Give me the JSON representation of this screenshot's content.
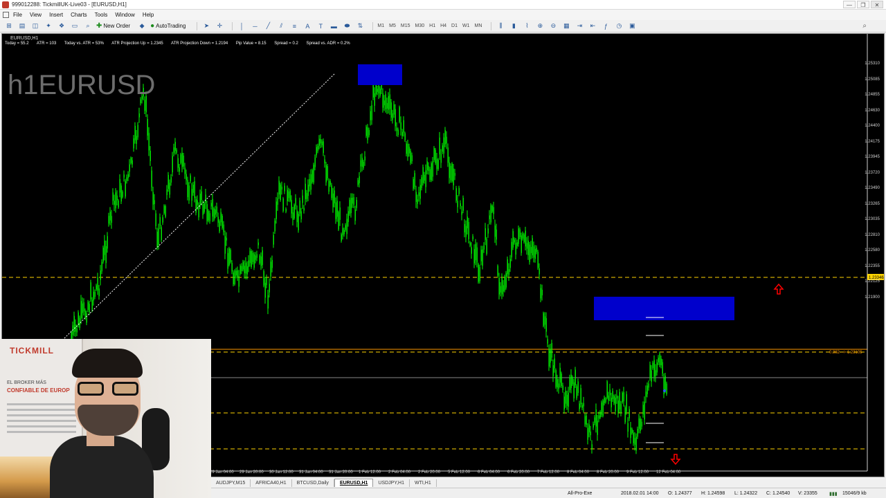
{
  "window": {
    "title": "999012288: TickmillUK-Live03 - [EURUSD,H1]",
    "controls": [
      "—",
      "❐",
      "✕"
    ]
  },
  "menu": [
    "File",
    "View",
    "Insert",
    "Charts",
    "Tools",
    "Window",
    "Help"
  ],
  "toolbar": {
    "new_order": "New Order",
    "autotrading": "AutoTrading",
    "timeframes": [
      "M1",
      "M5",
      "M15",
      "M30",
      "H1",
      "H4",
      "D1",
      "W1",
      "MN"
    ],
    "search_icon": "search-icon"
  },
  "chart": {
    "label": "EURUSD,H1",
    "watermark": "h1EURUSD",
    "info": {
      "today": "Today = 55.2",
      "atr": "ATR = 103",
      "today_vs_atr": "Today vs. ATR = 53%",
      "proj_up": "ATR Projection Up = 1.2345",
      "proj_down": "ATR Projection Down = 1.2194",
      "pip_value": "Pip Value = 8.15",
      "spread": "Spread = 0.2",
      "spread_vs_adr": "Spread vs. ADR = 0.2%"
    },
    "price_axis": [
      "1.25310",
      "1.25085",
      "1.24855",
      "1.24630",
      "1.24400",
      "1.24175",
      "1.23945",
      "1.23720",
      "1.23490",
      "1.23265",
      "1.23035",
      "1.22810",
      "1.22580",
      "1.22355",
      "1.22125",
      "1.21900"
    ],
    "price_levels_label": "1.23346",
    "fib_label": "0.382 --> 1.23105",
    "time_axis": [
      "29 Jan 04:00",
      "29 Jan 20:00",
      "30 Jan 12:00",
      "31 Jan 04:00",
      "31 Jan 20:00",
      "1 Feb 12:00",
      "2 Feb 04:00",
      "2 Feb 20:00",
      "5 Feb 12:00",
      "6 Feb 04:00",
      "6 Feb 20:00",
      "7 Feb 12:00",
      "8 Feb 04:00",
      "8 Feb 20:00",
      "9 Feb 12:00",
      "12 Feb 04:00"
    ],
    "colors": {
      "candle": "#00ff00",
      "zone": "#0000cc",
      "level_yellow": "#ffd400",
      "level_orange": "#ff9900",
      "arrow": "#ff0000",
      "trendline": "#ffffff"
    }
  },
  "tabs": [
    "AUDJPY,M15",
    "AFRICA40,H1",
    "BTCUSD,Daily",
    "EURUSD,H1",
    "USDJPY,H1",
    "WTI,H1"
  ],
  "active_tab": "EURUSD,H1",
  "status": {
    "profile": "All-Pro-Exe",
    "datetime": "2018.02.01 14:00",
    "open": "O: 1.24377",
    "high": "H: 1.24598",
    "low": "L: 1.24322",
    "close": "C: 1.24540",
    "volume": "V: 23355",
    "traffic": "15046/9 kb"
  },
  "webcam": {
    "banner_brand": "TICKMILL",
    "banner_line1": "EL BROKER MÁS",
    "banner_line2": "CONFIABLE DE EUROP"
  }
}
